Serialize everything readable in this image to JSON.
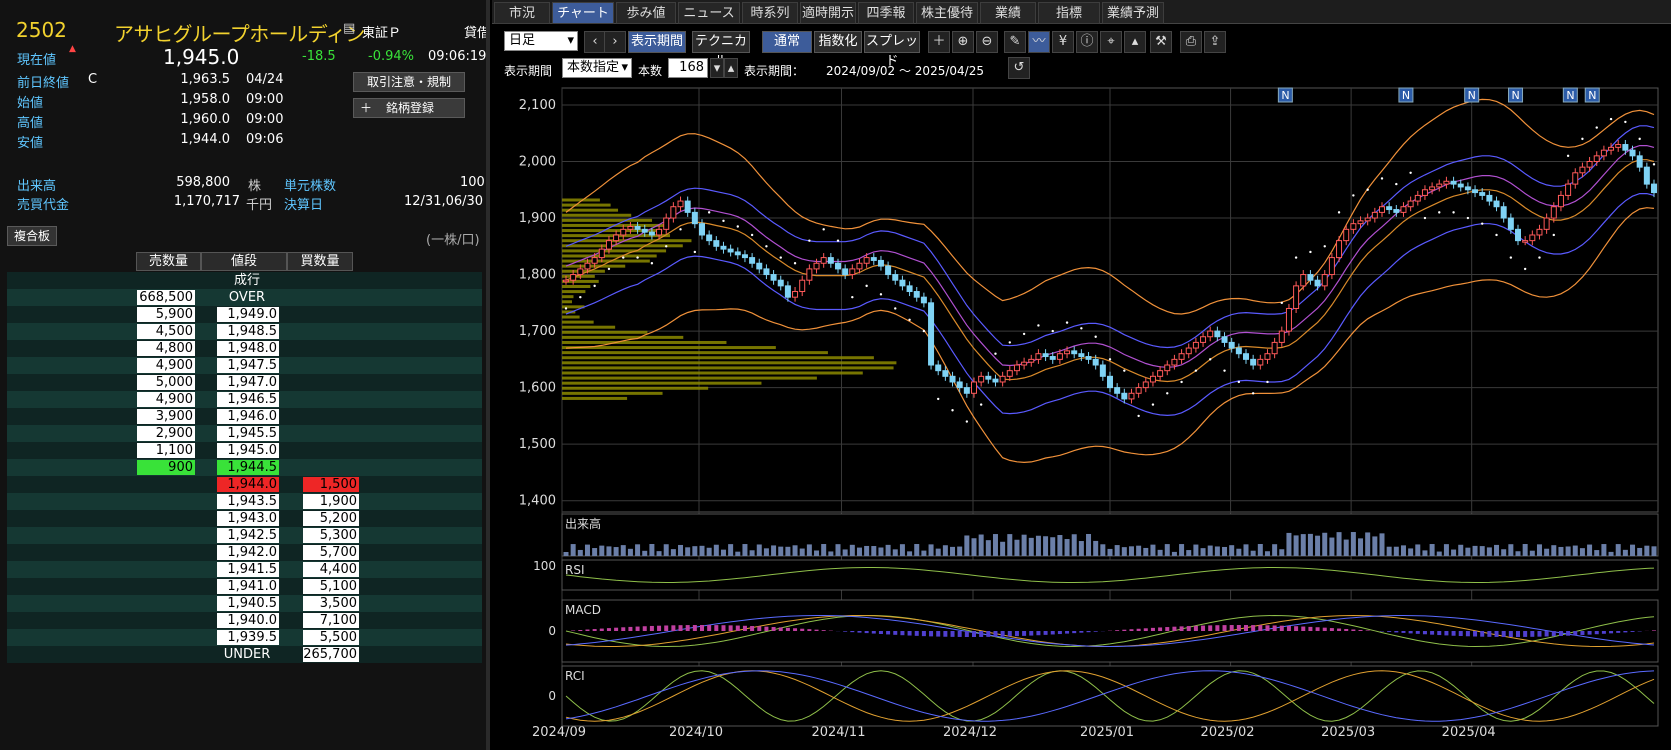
{
  "quote": {
    "code": "2502",
    "name": "アサヒグループホールディン",
    "market": "東証Ｐ",
    "lend": "貸借",
    "current_label": "現在値",
    "current_price": "1,945.0",
    "change": "-18.5",
    "change_pct": "-0.94%",
    "time": "09:06:19",
    "rows": [
      {
        "label": "前日終値",
        "flag": "C",
        "value": "1,963.5",
        "time": "04/24"
      },
      {
        "label": "始値",
        "flag": "",
        "value": "1,958.0",
        "time": "09:00"
      },
      {
        "label": "高値",
        "flag": "",
        "value": "1,960.0",
        "time": "09:00"
      },
      {
        "label": "安値",
        "flag": "",
        "value": "1,944.0",
        "time": "09:06"
      }
    ],
    "volume_label": "出来高",
    "volume": "598,800",
    "volume_unit": "株",
    "unit_label": "単元株数",
    "unit_value": "100",
    "turnover_label": "売買代金",
    "turnover": "1,170,717",
    "turnover_unit": "千円",
    "settle_label": "決算日",
    "settle_value": "12/31,06/30",
    "btn_notice": "取引注意・規制",
    "btn_register": "銘柄登録",
    "board_tab": "複合板",
    "per_share": "(一株/口)"
  },
  "board": {
    "headers": [
      "売数量",
      "値段",
      "買数量"
    ],
    "rows": [
      {
        "sell": "",
        "price": "成行",
        "buy": "",
        "ps": "",
        "pt": "text"
      },
      {
        "sell": "668,500",
        "price": "OVER",
        "buy": "",
        "ps": "white",
        "pt": "text"
      },
      {
        "sell": "5,900",
        "price": "1,949.0",
        "buy": "",
        "ps": "white",
        "pt": "white"
      },
      {
        "sell": "4,500",
        "price": "1,948.5",
        "buy": "",
        "ps": "white",
        "pt": "white"
      },
      {
        "sell": "4,800",
        "price": "1,948.0",
        "buy": "",
        "ps": "white",
        "pt": "white"
      },
      {
        "sell": "4,900",
        "price": "1,947.5",
        "buy": "",
        "ps": "white",
        "pt": "white"
      },
      {
        "sell": "5,000",
        "price": "1,947.0",
        "buy": "",
        "ps": "white",
        "pt": "white"
      },
      {
        "sell": "4,900",
        "price": "1,946.5",
        "buy": "",
        "ps": "white",
        "pt": "white"
      },
      {
        "sell": "3,900",
        "price": "1,946.0",
        "buy": "",
        "ps": "white",
        "pt": "white"
      },
      {
        "sell": "2,900",
        "price": "1,945.5",
        "buy": "",
        "ps": "white",
        "pt": "white"
      },
      {
        "sell": "1,100",
        "price": "1,945.0",
        "buy": "",
        "ps": "white",
        "pt": "white"
      },
      {
        "sell": "900",
        "price": "1,944.5",
        "buy": "",
        "ps": "green",
        "pt": "green"
      },
      {
        "sell": "",
        "price": "1,944.0",
        "buy": "1,500",
        "ps": "",
        "pt": "red",
        "bs": "red"
      },
      {
        "sell": "",
        "price": "1,943.5",
        "buy": "1,900",
        "ps": "",
        "pt": "white",
        "bs": "white"
      },
      {
        "sell": "",
        "price": "1,943.0",
        "buy": "5,200",
        "ps": "",
        "pt": "white",
        "bs": "white"
      },
      {
        "sell": "",
        "price": "1,942.5",
        "buy": "5,300",
        "ps": "",
        "pt": "white",
        "bs": "white"
      },
      {
        "sell": "",
        "price": "1,942.0",
        "buy": "5,700",
        "ps": "",
        "pt": "white",
        "bs": "white"
      },
      {
        "sell": "",
        "price": "1,941.5",
        "buy": "4,400",
        "ps": "",
        "pt": "white",
        "bs": "white"
      },
      {
        "sell": "",
        "price": "1,941.0",
        "buy": "5,100",
        "ps": "",
        "pt": "white",
        "bs": "white"
      },
      {
        "sell": "",
        "price": "1,940.5",
        "buy": "3,500",
        "ps": "",
        "pt": "white",
        "bs": "white"
      },
      {
        "sell": "",
        "price": "1,940.0",
        "buy": "7,100",
        "ps": "",
        "pt": "white",
        "bs": "white"
      },
      {
        "sell": "",
        "price": "1,939.5",
        "buy": "5,500",
        "ps": "",
        "pt": "white",
        "bs": "white"
      },
      {
        "sell": "",
        "price": "UNDER",
        "buy": "265,700",
        "ps": "",
        "pt": "text",
        "bs": "white"
      }
    ]
  },
  "tabs": [
    "市況",
    "チャート",
    "歩み値",
    "ニュース",
    "時系列",
    "適時開示",
    "四季報",
    "株主優待",
    "業績",
    "指標",
    "業績予測"
  ],
  "active_tab": "チャート",
  "toolbar": {
    "period_select": "日足",
    "display_period": "表示期間",
    "technical": "テクニカル",
    "normal": "通常",
    "index": "指数化",
    "spread": "スプレッド",
    "range_label": "表示期間",
    "range_mode": "本数指定",
    "count_label": "本数",
    "count_value": "168",
    "period_text_label": "表示期間：",
    "period_text": "2024/09/02 ～ 2025/04/25"
  },
  "panels": {
    "volume": "出来高",
    "rsi": "RSI",
    "rsi_scale": "100",
    "macd": "MACD",
    "macd_zero": "0",
    "rci": "RCI",
    "rci_zero": "0"
  },
  "news_marker": "N",
  "colors": {
    "up": "#ff5a5a",
    "down": "#7fd3f5",
    "volume_profile": "#8c8a00",
    "bb_outer": "#f0913a",
    "ma": "#6b6bff",
    "dots": "#ffffff"
  },
  "chart_data": {
    "type": "candlestick",
    "yticks": [
      "2,100",
      "2,000",
      "1,900",
      "1,800",
      "1,700",
      "1,600",
      "1,500",
      "1,400"
    ],
    "ylim": [
      1380,
      2130
    ],
    "xticks": [
      "2024/09",
      "2024/10",
      "2024/11",
      "2024/12",
      "2025/01",
      "2025/02",
      "2025/03",
      "2025/04"
    ],
    "close_series": [
      1790,
      1800,
      1810,
      1820,
      1830,
      1845,
      1860,
      1870,
      1880,
      1885,
      1880,
      1875,
      1870,
      1880,
      1900,
      1920,
      1930,
      1910,
      1890,
      1870,
      1860,
      1850,
      1845,
      1840,
      1835,
      1830,
      1820,
      1810,
      1800,
      1790,
      1780,
      1760,
      1770,
      1790,
      1810,
      1820,
      1830,
      1820,
      1810,
      1800,
      1810,
      1820,
      1830,
      1825,
      1815,
      1800,
      1790,
      1780,
      1770,
      1760,
      1750,
      1640,
      1630,
      1620,
      1610,
      1600,
      1590,
      1610,
      1620,
      1615,
      1610,
      1620,
      1630,
      1640,
      1645,
      1650,
      1660,
      1655,
      1650,
      1660,
      1665,
      1660,
      1655,
      1650,
      1640,
      1620,
      1600,
      1590,
      1580,
      1590,
      1600,
      1610,
      1620,
      1630,
      1640,
      1650,
      1660,
      1670,
      1680,
      1690,
      1700,
      1690,
      1680,
      1670,
      1660,
      1650,
      1640,
      1650,
      1660,
      1680,
      1700,
      1740,
      1780,
      1800,
      1790,
      1780,
      1800,
      1830,
      1860,
      1880,
      1890,
      1895,
      1900,
      1910,
      1920,
      1915,
      1910,
      1920,
      1930,
      1940,
      1950,
      1955,
      1960,
      1965,
      1960,
      1955,
      1950,
      1945,
      1940,
      1930,
      1920,
      1900,
      1880,
      1860,
      1860,
      1870,
      1880,
      1900,
      1920,
      1940,
      1960,
      1980,
      1990,
      2000,
      2010,
      2020,
      2025,
      2030,
      2020,
      2010,
      1990,
      1960,
      1945
    ],
    "news_positions": [
      0.66,
      0.77,
      0.83,
      0.87,
      0.92,
      0.94
    ]
  }
}
